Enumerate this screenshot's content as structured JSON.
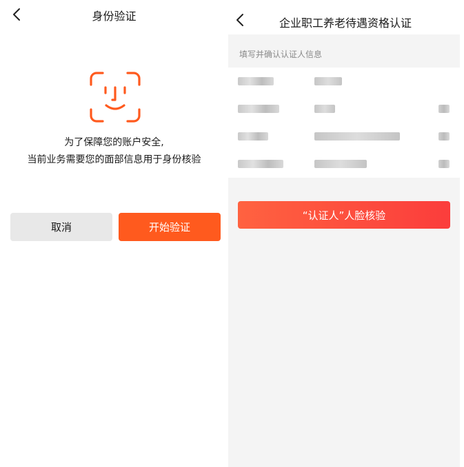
{
  "left_screen": {
    "title": "身份验证",
    "prompt_line1": "为了保障您的账户安全,",
    "prompt_line2": "当前业务需要您的面部信息用于身份核验",
    "cancel_label": "取消",
    "start_label": "开始验证"
  },
  "right_screen": {
    "title": "企业职工养老待遇资格认证",
    "section_label": "填写并确认认证人信息",
    "face_verify_label": "“认证人”人脸核验"
  },
  "colors": {
    "accent_orange": "#ff5a1e",
    "accent_red": "#fb3d3c",
    "face_icon": "#ff5a1e"
  },
  "icons": {
    "back": "chevron-left-icon",
    "face": "face-id-icon"
  }
}
